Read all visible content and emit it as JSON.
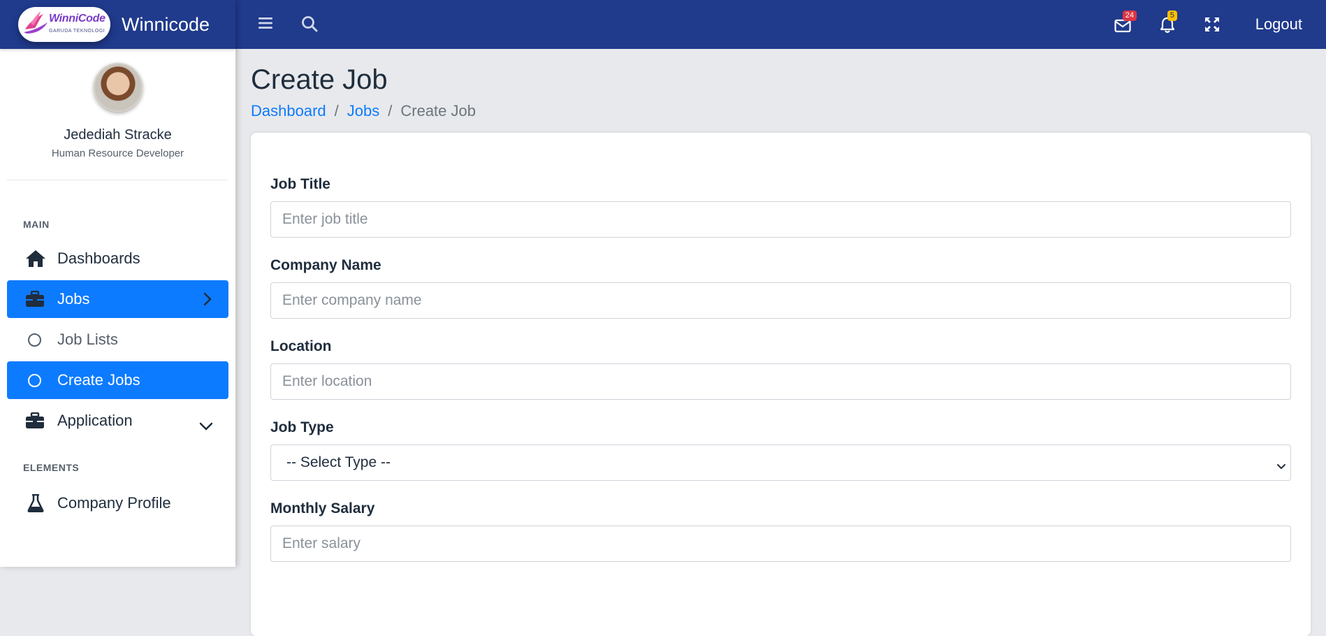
{
  "brand": {
    "logo_text": "WinniCode",
    "logo_subtext": "GARUDA TEKNOLOGI",
    "name": "Winnicode"
  },
  "profile": {
    "name": "Jedediah Stracke",
    "role": "Human Resource Developer"
  },
  "sidebar": {
    "section_main": "MAIN",
    "section_elements": "ELEMENTS",
    "items": [
      {
        "label": "Dashboards",
        "icon": "home-icon"
      },
      {
        "label": "Jobs",
        "icon": "briefcase-icon",
        "active": true
      },
      {
        "label": "Job Lists",
        "icon": "circle-icon"
      },
      {
        "label": "Create Jobs",
        "icon": "circle-icon",
        "active": true
      },
      {
        "label": "Application",
        "icon": "briefcase-icon"
      },
      {
        "label": "Company Profile",
        "icon": "flask-icon"
      }
    ]
  },
  "topbar": {
    "messages_count": "24",
    "notifications_count": "5",
    "logout_label": "Logout"
  },
  "page": {
    "title": "Create Job",
    "breadcrumb": [
      "Dashboard",
      "Jobs",
      "Create Job"
    ]
  },
  "form": {
    "job_title_label": "Job Title",
    "job_title_placeholder": "Enter job title",
    "company_label": "Company Name",
    "company_placeholder": "Enter company name",
    "location_label": "Location",
    "location_placeholder": "Enter location",
    "job_type_label": "Job Type",
    "job_type_selected": "-- Select Type --",
    "salary_label": "Monthly Salary",
    "salary_placeholder": "Enter salary"
  },
  "colors": {
    "topbar": "#203a8c",
    "accent": "#0d7bff",
    "badge_red": "#dc3545",
    "badge_yellow": "#ffc107"
  }
}
